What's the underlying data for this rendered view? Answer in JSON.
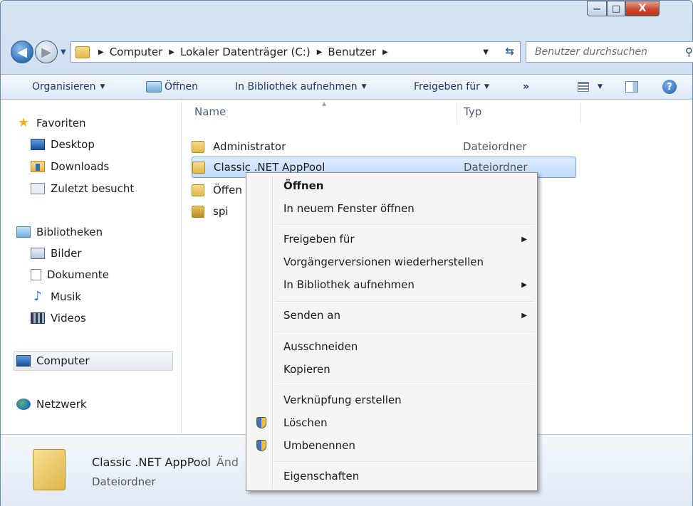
{
  "window": {
    "caption": {
      "minimize": "—",
      "maximize": "□",
      "close": "X"
    }
  },
  "address": {
    "path": [
      "Computer",
      "Lokaler Datenträger (C:)",
      "Benutzer"
    ],
    "search_placeholder": "Benutzer durchsuchen",
    "icons": {
      "back": "back-arrow",
      "forward": "forward-arrow",
      "refresh": "refresh-icon",
      "search": "search-icon"
    }
  },
  "toolbar": {
    "organize": "Organisieren",
    "open": "Öffnen",
    "library": "In Bibliothek aufnehmen",
    "share": "Freigeben für",
    "more": "»"
  },
  "nav": {
    "favorites": "Favoriten",
    "desktop": "Desktop",
    "downloads": "Downloads",
    "recent": "Zuletzt besucht",
    "libraries": "Bibliotheken",
    "pictures": "Bilder",
    "documents": "Dokumente",
    "music": "Musik",
    "videos": "Videos",
    "computer": "Computer",
    "network": "Netzwerk"
  },
  "files": {
    "columns": {
      "name": "Name",
      "type": "Typ"
    },
    "rows": [
      {
        "name": "Administrator",
        "type": "Dateiordner"
      },
      {
        "name": "Classic .NET AppPool",
        "type": "Dateiordner"
      },
      {
        "name": "Öffen",
        "type": ""
      },
      {
        "name": "spi",
        "type": ""
      }
    ]
  },
  "context_menu": {
    "open": "Öffnen",
    "open_new_window": "In neuem Fenster öffnen",
    "share": "Freigeben für",
    "restore_versions": "Vorgängerversionen wiederherstellen",
    "add_library": "In Bibliothek aufnehmen",
    "send_to": "Senden an",
    "cut": "Ausschneiden",
    "copy": "Kopieren",
    "create_shortcut": "Verknüpfung erstellen",
    "delete": "Löschen",
    "rename": "Umbenennen",
    "properties": "Eigenschaften"
  },
  "details": {
    "name": "Classic .NET AppPool",
    "extra": "Änd",
    "type": "Dateiordner"
  }
}
